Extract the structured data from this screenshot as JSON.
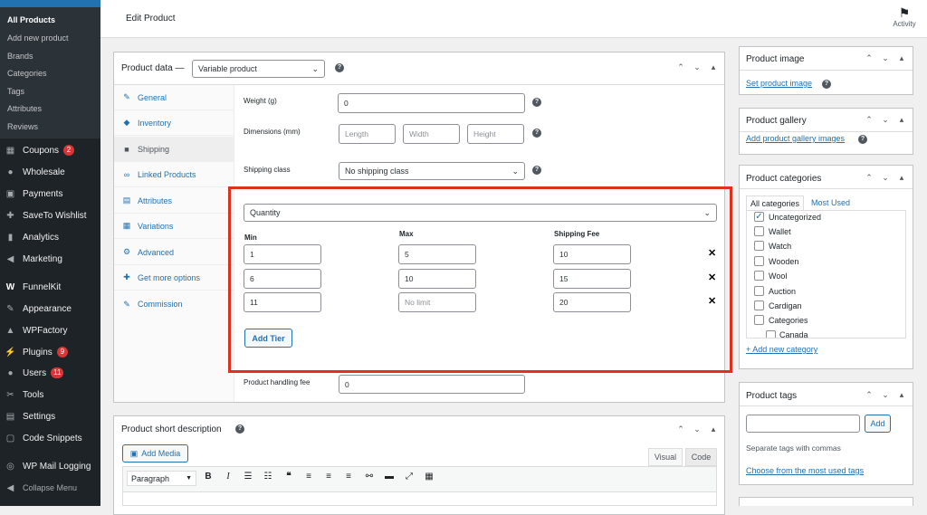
{
  "sidebar": {
    "submenu": [
      "All Products",
      "Add new product",
      "Brands",
      "Categories",
      "Tags",
      "Attributes",
      "Reviews"
    ],
    "menu": [
      {
        "label": "Coupons",
        "icon": "coupon-icon",
        "badge": "2"
      },
      {
        "label": "Wholesale",
        "icon": "wholesale-icon"
      },
      {
        "label": "Payments",
        "icon": "payments-icon"
      },
      {
        "label": "SaveTo Wishlist",
        "icon": "wishlist-icon"
      },
      {
        "label": "Analytics",
        "icon": "analytics-icon"
      },
      {
        "label": "Marketing",
        "icon": "marketing-icon"
      },
      {
        "label": "FunnelKit",
        "icon": "funnelkit-icon"
      },
      {
        "label": "Appearance",
        "icon": "appearance-icon"
      },
      {
        "label": "WPFactory",
        "icon": "wpfactory-icon"
      },
      {
        "label": "Plugins",
        "icon": "plugins-icon",
        "badge": "9"
      },
      {
        "label": "Users",
        "icon": "users-icon",
        "badge": "11"
      },
      {
        "label": "Tools",
        "icon": "tools-icon"
      },
      {
        "label": "Settings",
        "icon": "settings-icon"
      },
      {
        "label": "Code Snippets",
        "icon": "code-icon"
      },
      {
        "label": "WP Mail Logging",
        "icon": "mail-icon"
      },
      {
        "label": "Collapse Menu",
        "icon": "collapse-icon"
      }
    ]
  },
  "header": {
    "title": "Edit Product",
    "activity": "Activity"
  },
  "product_data": {
    "title": "Product data —",
    "type": "Variable product",
    "tabs": [
      "General",
      "Inventory",
      "Shipping",
      "Linked Products",
      "Attributes",
      "Variations",
      "Advanced",
      "Get more options",
      "Commission"
    ],
    "weight_label": "Weight (g)",
    "weight_value": "0",
    "dimensions_label": "Dimensions (mm)",
    "length_ph": "Length",
    "width_ph": "Width",
    "height_ph": "Height",
    "shipping_class_label": "Shipping class",
    "shipping_class": "No shipping class",
    "tier_basis": "Quantity",
    "col_min": "Min",
    "col_max": "Max",
    "col_fee": "Shipping Fee",
    "tiers": [
      {
        "min": "1",
        "max": "5",
        "fee": "10"
      },
      {
        "min": "6",
        "max": "10",
        "fee": "15"
      },
      {
        "min": "11",
        "max": "No limit",
        "fee": "20"
      }
    ],
    "add_tier": "Add Tier",
    "handling_label": "Product handling fee",
    "handling_value": "0"
  },
  "short_desc": {
    "title": "Product short description",
    "add_media": "Add Media",
    "tab_visual": "Visual",
    "tab_code": "Code",
    "format": "Paragraph"
  },
  "product_image": {
    "title": "Product image",
    "link": "Set product image"
  },
  "product_gallery": {
    "title": "Product gallery",
    "link": "Add product gallery images"
  },
  "categories": {
    "title": "Product categories",
    "tab_all": "All categories",
    "tab_used": "Most Used",
    "items": [
      "Uncategorized",
      "Wallet",
      "Watch",
      "Wooden",
      "Wool",
      "Auction",
      "Cardigan",
      "Categories",
      "Canada"
    ],
    "add_new": "+ Add new category"
  },
  "tags": {
    "title": "Product tags",
    "add": "Add",
    "help": "Separate tags with commas",
    "choose": "Choose from the most used tags"
  },
  "colors": {
    "highlight": "#e0301e",
    "link": "#2271b1",
    "sidebar": "#1d2327"
  }
}
